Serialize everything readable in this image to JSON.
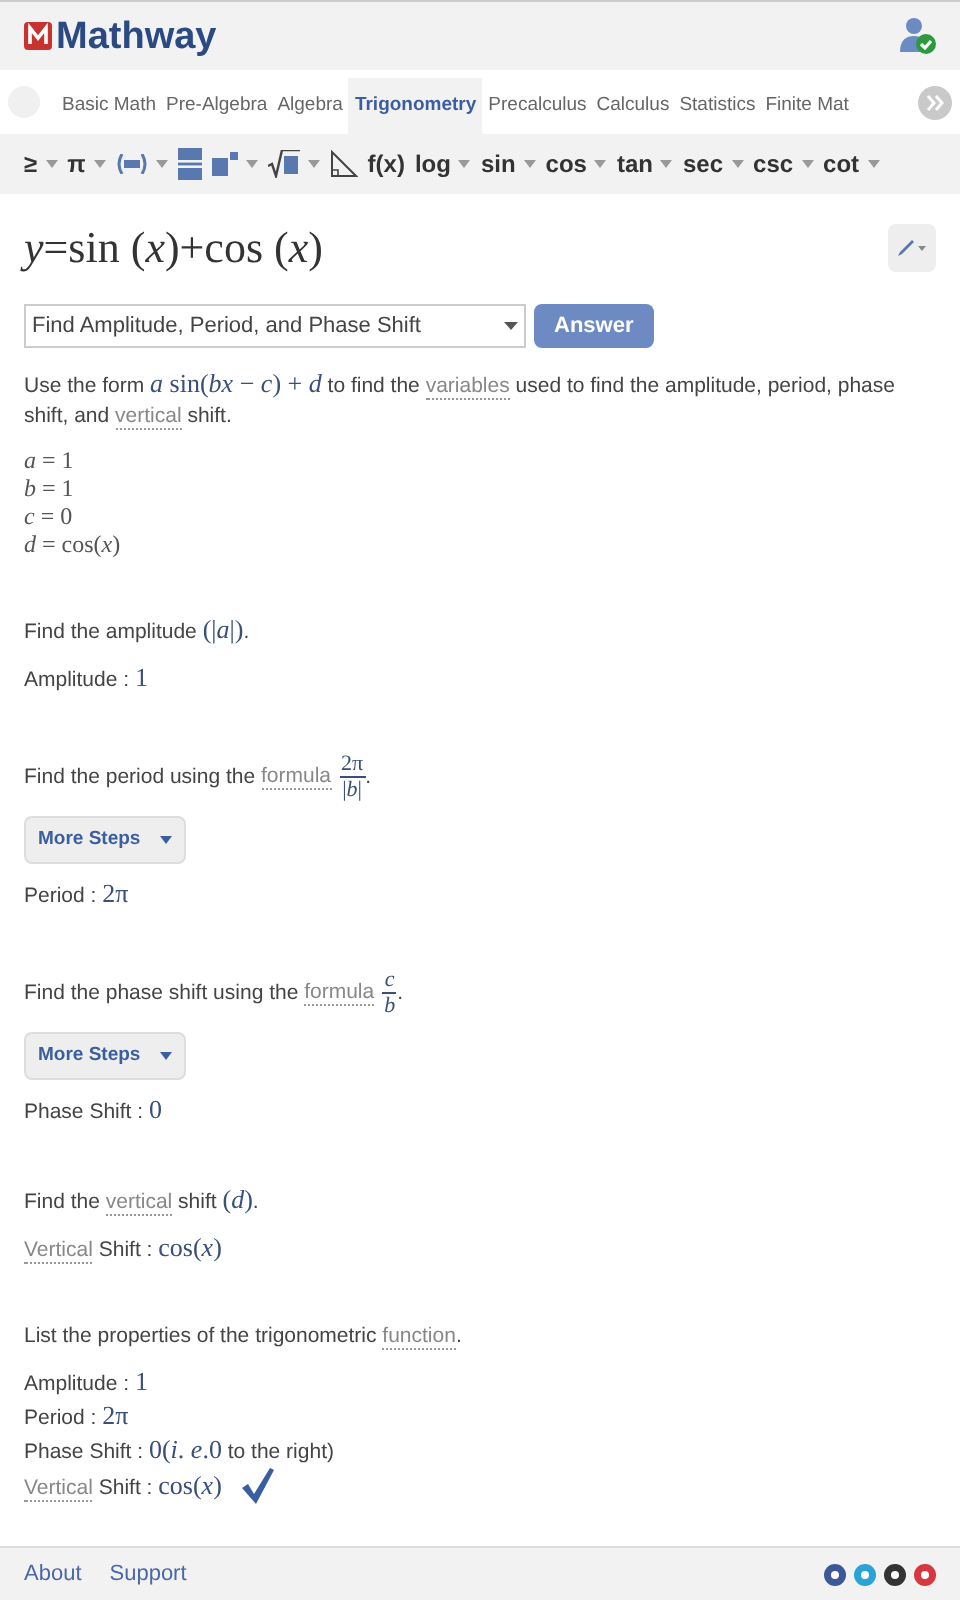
{
  "header": {
    "logo": "Mathway"
  },
  "tabs": [
    {
      "label": "Basic Math",
      "selected": false
    },
    {
      "label": "Pre-Algebra",
      "selected": false
    },
    {
      "label": "Algebra",
      "selected": false
    },
    {
      "label": "Trigonometry",
      "selected": true
    },
    {
      "label": "Precalculus",
      "selected": false
    },
    {
      "label": "Calculus",
      "selected": false
    },
    {
      "label": "Statistics",
      "selected": false
    },
    {
      "label": "Finite Mat",
      "selected": false
    }
  ],
  "toolbar": [
    {
      "kind": "text",
      "label": "≥",
      "menu": true
    },
    {
      "kind": "text",
      "label": "π",
      "menu": true
    },
    {
      "kind": "parens",
      "menu": true
    },
    {
      "kind": "fraction",
      "menu": false
    },
    {
      "kind": "power",
      "menu": true
    },
    {
      "kind": "sqrt",
      "menu": true
    },
    {
      "kind": "triangle",
      "menu": false
    },
    {
      "kind": "text",
      "label": "f(x)",
      "menu": false
    },
    {
      "kind": "text",
      "label": "log",
      "menu": true
    },
    {
      "kind": "text",
      "label": "sin",
      "menu": true
    },
    {
      "kind": "text",
      "label": "cos",
      "menu": true
    },
    {
      "kind": "text",
      "label": "tan",
      "menu": true
    },
    {
      "kind": "text",
      "label": "sec",
      "menu": true
    },
    {
      "kind": "text",
      "label": "csc",
      "menu": true
    },
    {
      "kind": "text",
      "label": "cot",
      "menu": true
    }
  ],
  "problem": "*y*=sin (*x*)+cos (*x*)",
  "task_select": {
    "value": "Find Amplitude, Period, and Phase Shift"
  },
  "answer_button": "Answer",
  "sections": [
    [
      {
        "kind": "p",
        "segments": [
          {
            "kind": "text",
            "text": "Use the form "
          },
          {
            "kind": "math",
            "text": "*a* sin(*bx* − *c*) + *d*"
          },
          {
            "kind": "text",
            "text": " to find the "
          },
          {
            "kind": "link",
            "text": "variables"
          },
          {
            "kind": "text",
            "text": " used to find the amplitude, period, phase shift, and "
          },
          {
            "kind": "link",
            "text": "vertical"
          },
          {
            "kind": "text",
            "text": " shift."
          }
        ]
      },
      {
        "kind": "math",
        "lines": [
          "*a* = 1",
          "*b* = 1",
          "*c* = 0",
          "*d* = cos(*x*)"
        ]
      }
    ],
    [
      {
        "kind": "p",
        "segments": [
          {
            "kind": "text",
            "text": "Find the amplitude "
          },
          {
            "kind": "math",
            "text": "(|*a*|)"
          },
          {
            "kind": "text",
            "text": "."
          }
        ]
      },
      {
        "kind": "p",
        "segments": [
          {
            "kind": "text",
            "text": "Amplitude : "
          },
          {
            "kind": "math",
            "text": "1"
          }
        ]
      }
    ],
    [
      {
        "kind": "p",
        "segments": [
          {
            "kind": "text",
            "text": "Find the period using the "
          },
          {
            "kind": "link",
            "text": "formula"
          },
          {
            "kind": "fraction",
            "num": "2π",
            "den": "|*b*|"
          },
          {
            "kind": "text",
            "text": "."
          }
        ]
      },
      {
        "kind": "more_steps",
        "label": "More Steps"
      },
      {
        "kind": "p",
        "segments": [
          {
            "kind": "text",
            "text": "Period : "
          },
          {
            "kind": "math",
            "text": "2π"
          }
        ]
      }
    ],
    [
      {
        "kind": "p",
        "segments": [
          {
            "kind": "text",
            "text": "Find the phase shift using the "
          },
          {
            "kind": "link",
            "text": "formula"
          },
          {
            "kind": "fraction",
            "num": "*c*",
            "den": "*b*"
          },
          {
            "kind": "text",
            "text": "."
          }
        ]
      },
      {
        "kind": "more_steps",
        "label": "More Steps"
      },
      {
        "kind": "p",
        "segments": [
          {
            "kind": "text",
            "text": "Phase Shift : "
          },
          {
            "kind": "math",
            "text": "0"
          }
        ]
      }
    ],
    [
      {
        "kind": "p",
        "segments": [
          {
            "kind": "text",
            "text": "Find the "
          },
          {
            "kind": "link",
            "text": "vertical"
          },
          {
            "kind": "text",
            "text": " shift "
          },
          {
            "kind": "math",
            "text": "(*d*)"
          },
          {
            "kind": "text",
            "text": "."
          }
        ]
      },
      {
        "kind": "p",
        "segments": [
          {
            "kind": "link",
            "text": "Vertical"
          },
          {
            "kind": "text",
            "text": " Shift : "
          },
          {
            "kind": "math",
            "text": "cos(*x*)"
          }
        ]
      }
    ],
    [
      {
        "kind": "p",
        "segments": [
          {
            "kind": "text",
            "text": "List the properties of the trigonometric "
          },
          {
            "kind": "link",
            "text": "function"
          },
          {
            "kind": "text",
            "text": "."
          }
        ]
      },
      {
        "kind": "lines",
        "properties": [
          {
            "segments": [
              {
                "kind": "text",
                "text": "Amplitude : "
              },
              {
                "kind": "math",
                "text": "1"
              }
            ]
          },
          {
            "segments": [
              {
                "kind": "text",
                "text": "Period : "
              },
              {
                "kind": "math",
                "text": "2π"
              }
            ]
          },
          {
            "segments": [
              {
                "kind": "text",
                "text": "Phase Shift : "
              },
              {
                "kind": "math",
                "text": "0(*i*. *e*.0"
              },
              {
                "kind": "text",
                "text": " to the right)"
              }
            ]
          },
          {
            "segments": [
              {
                "kind": "link",
                "text": "Vertical"
              },
              {
                "kind": "text",
                "text": " Shift : "
              },
              {
                "kind": "math",
                "text": "cos(*x*)"
              }
            ]
          }
        ],
        "verified": true
      }
    ]
  ],
  "footer": {
    "links": [
      "About",
      "Support"
    ]
  }
}
